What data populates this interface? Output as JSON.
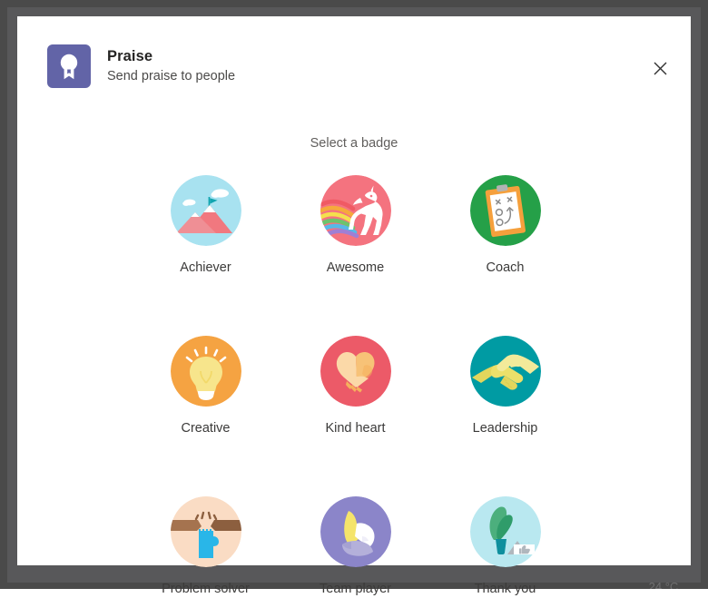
{
  "window": {
    "frame_color": "#4a4a4a",
    "surface_color": "#ffffff"
  },
  "header": {
    "app_icon_name": "praise-ribbon-icon",
    "app_icon_color": "#6264a7",
    "title": "Praise",
    "subtitle": "Send praise to people",
    "close_label": "Close"
  },
  "main": {
    "instruction": "Select a badge"
  },
  "badges": [
    {
      "id": "achiever",
      "label": "Achiever",
      "icon_name": "mountain-flag-icon",
      "bg": "#a8e2f0",
      "colors": [
        "#f1787f",
        "#ef8f95",
        "#ffffff",
        "#12a5b0"
      ]
    },
    {
      "id": "awesome",
      "label": "Awesome",
      "icon_name": "unicorn-rainbow-icon",
      "bg": "#f4737f",
      "colors": [
        "#ffffff",
        "#f0545f",
        "#f6a93c",
        "#f4e04d",
        "#6dc36d",
        "#56b9e8",
        "#9f7fd4"
      ]
    },
    {
      "id": "coach",
      "label": "Coach",
      "icon_name": "clipboard-playbook-icon",
      "bg": "#25a048",
      "colors": [
        "#f5a03c",
        "#ffffff",
        "#b3b3b3",
        "#8a8a8a"
      ]
    },
    {
      "id": "creative",
      "label": "Creative",
      "icon_name": "lightbulb-icon",
      "bg": "#f5a342",
      "colors": [
        "#f7e58c",
        "#ffffff",
        "#f2d96a"
      ]
    },
    {
      "id": "kind-heart",
      "label": "Kind heart",
      "icon_name": "hands-heart-icon",
      "bg": "#ec5a68",
      "colors": [
        "#fbd9a8",
        "#f7c277",
        "#f5b15c"
      ]
    },
    {
      "id": "leadership",
      "label": "Leadership",
      "icon_name": "handshake-icon",
      "bg": "#009ba3",
      "colors": [
        "#ece06a",
        "#e3d65c",
        "#f2ea9a"
      ]
    },
    {
      "id": "problem-solver",
      "label": "Problem solver",
      "icon_name": "puzzle-hands-icon",
      "bg": "#fadcc4",
      "colors": [
        "#a5734f",
        "#29b6e8",
        "#8c5f3f"
      ]
    },
    {
      "id": "team-player",
      "label": "Team player",
      "icon_name": "stacked-hands-icon",
      "bg": "#8b85c9",
      "colors": [
        "#f5e46a",
        "#ffffff",
        "#b4b0da"
      ]
    },
    {
      "id": "thank-you",
      "label": "Thank you",
      "icon_name": "plant-thumbsup-icon",
      "bg": "#b9e8f0",
      "colors": [
        "#4caf7d",
        "#2f9c6a",
        "#0f8f9e",
        "#ffffff",
        "#b0b7bd"
      ]
    }
  ],
  "artifact": {
    "bottom_text": "24 °C"
  }
}
